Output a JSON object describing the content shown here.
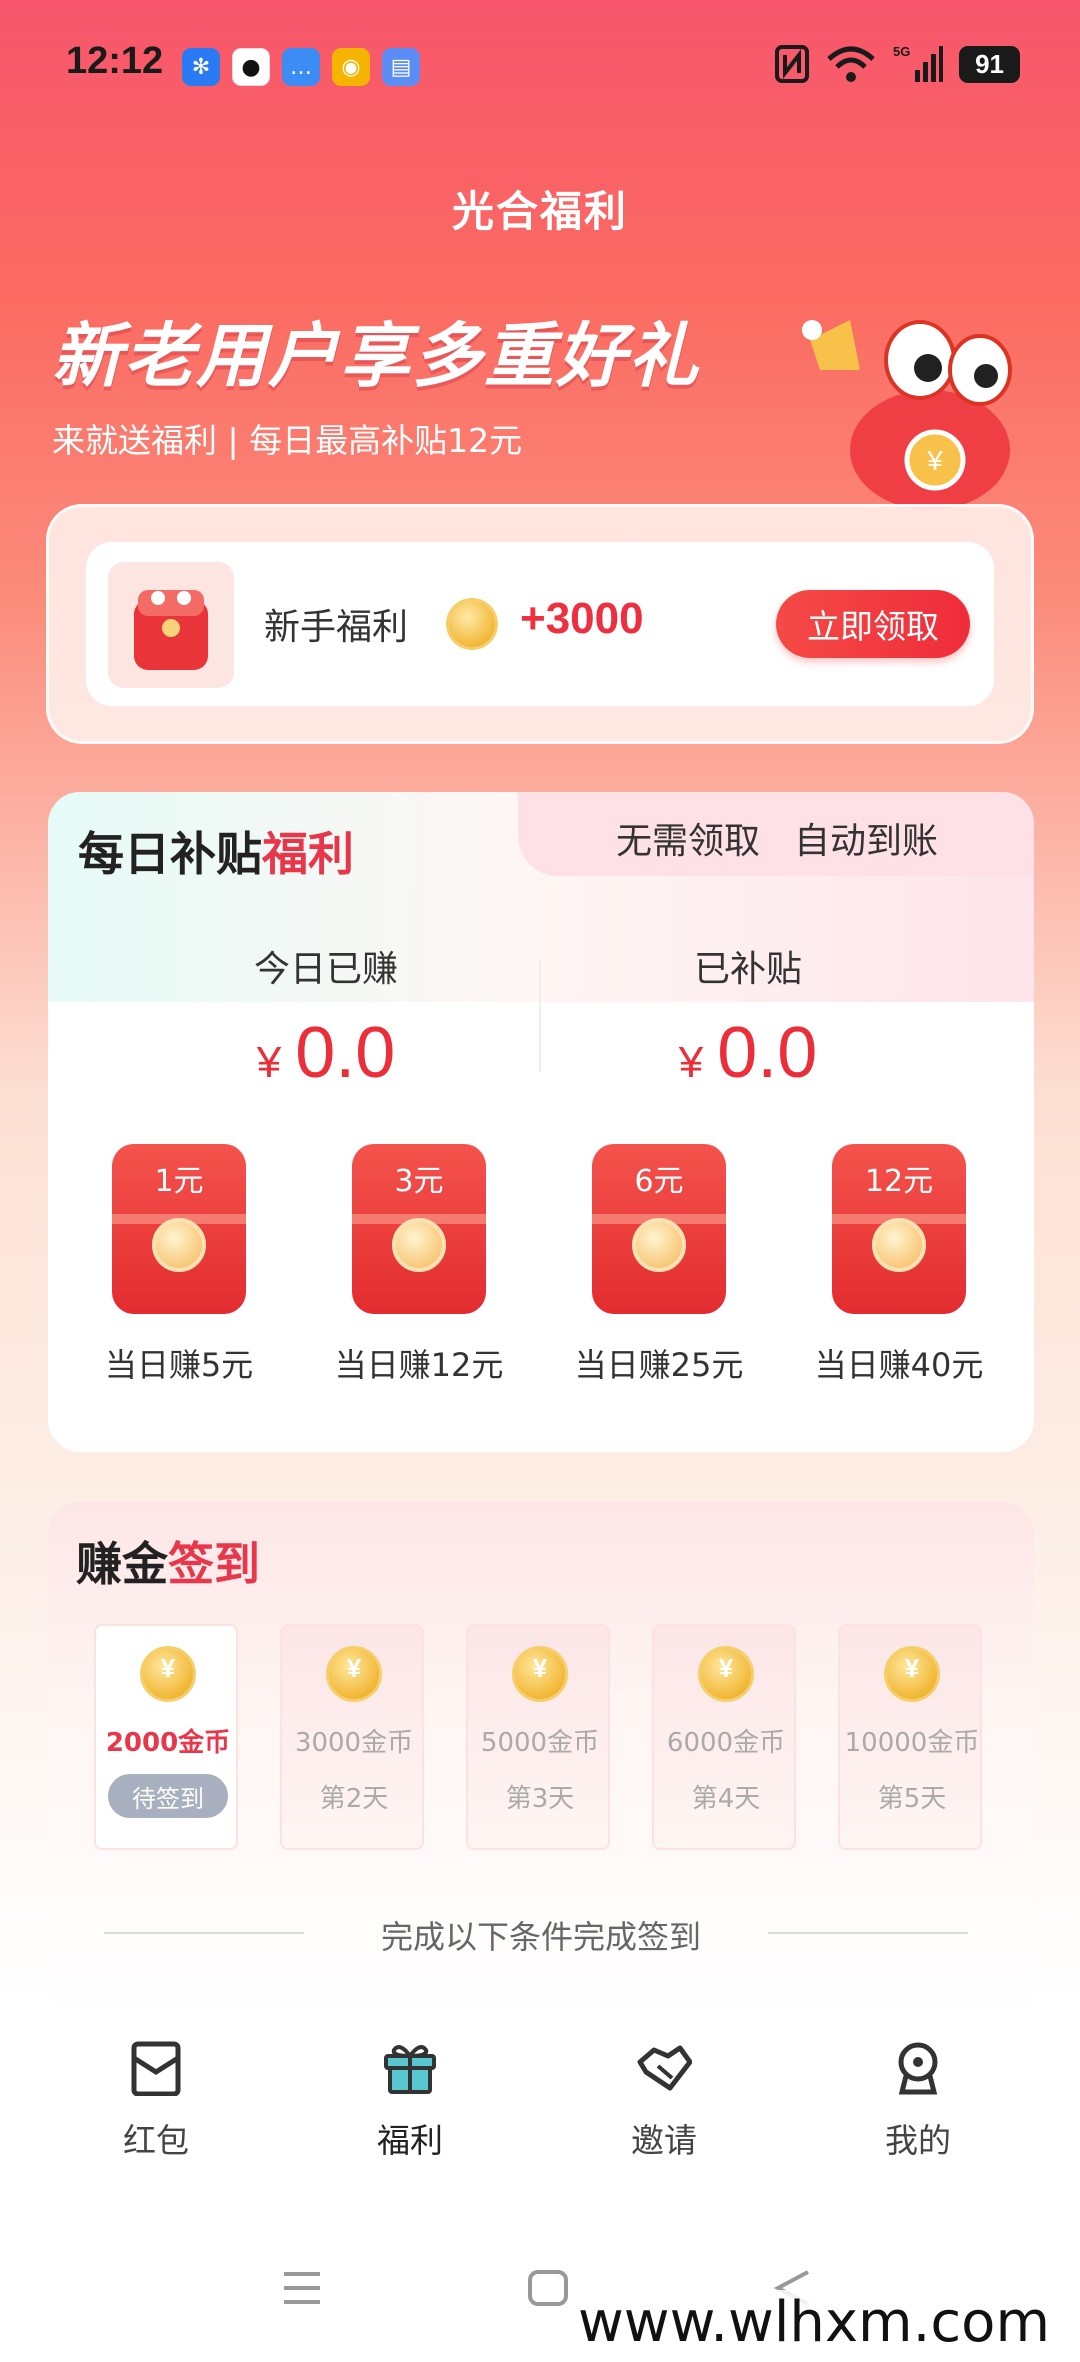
{
  "status_bar": {
    "time": "12:12",
    "battery": "91",
    "network": "5G"
  },
  "header": {
    "title": "光合福利",
    "hero_title": "新老用户享多重好礼",
    "hero_subtitle": "来就送福利 | 每日最高补贴12元"
  },
  "newbie": {
    "label": "新手福利",
    "amount": "+3000",
    "claim_button": "立即领取"
  },
  "daily": {
    "title_part1": "每日补贴",
    "title_part2": "福利",
    "tag1": "无需领取",
    "tag2": "自动到账",
    "earned_label": "今日已赚",
    "earned_value": "0.0",
    "subsidy_label": "已补贴",
    "subsidy_value": "0.0",
    "currency": "¥",
    "rewards": [
      {
        "amount": "1元",
        "caption": "当日赚5元"
      },
      {
        "amount": "3元",
        "caption": "当日赚12元"
      },
      {
        "amount": "6元",
        "caption": "当日赚25元"
      },
      {
        "amount": "12元",
        "caption": "当日赚40元"
      }
    ]
  },
  "signin": {
    "title_part1": "赚金",
    "title_part2": "签到",
    "days": [
      {
        "coins": "2000金币",
        "status": "待签到"
      },
      {
        "coins": "3000金币",
        "status": "第2天"
      },
      {
        "coins": "5000金币",
        "status": "第3天"
      },
      {
        "coins": "6000金币",
        "status": "第4天"
      },
      {
        "coins": "10000金币",
        "status": "第5天"
      }
    ],
    "condition_text": "完成以下条件完成签到"
  },
  "bottom_nav": {
    "items": [
      {
        "label": "红包",
        "icon": "red-envelope-icon"
      },
      {
        "label": "福利",
        "icon": "gift-icon",
        "active": true
      },
      {
        "label": "邀请",
        "icon": "handshake-icon"
      },
      {
        "label": "我的",
        "icon": "profile-icon"
      }
    ]
  },
  "watermark": "www.wlhxm.com",
  "colors": {
    "accent": "#ec2e3a",
    "active_nav": "#2aa7b8"
  }
}
